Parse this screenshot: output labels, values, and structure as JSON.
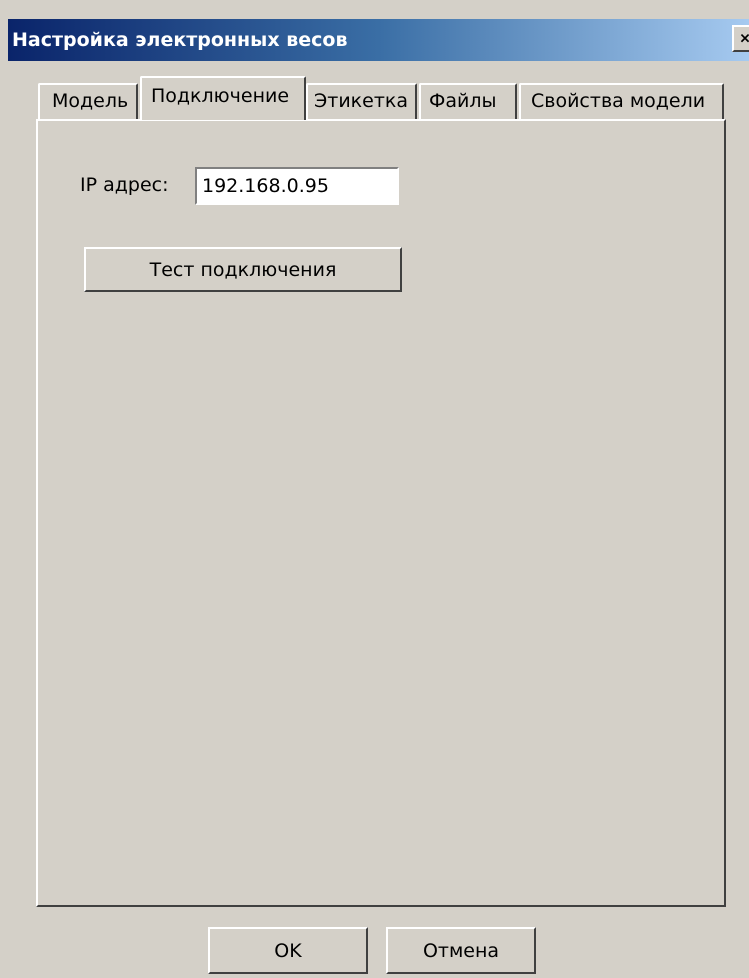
{
  "window": {
    "title": "Настройка электронных весов",
    "close_icon": "close-icon"
  },
  "tabs": [
    {
      "label": "Модель",
      "active": false
    },
    {
      "label": "Подключение",
      "active": true
    },
    {
      "label": "Этикетка",
      "active": false
    },
    {
      "label": "Файлы",
      "active": false
    },
    {
      "label": "Свойства модели",
      "active": false
    }
  ],
  "connection": {
    "ip_label": "IP адрес:",
    "ip_value": "192.168.0.95",
    "test_button_label": "Тест подключения"
  },
  "footer": {
    "ok_label": "OK",
    "cancel_label": "Отмена"
  },
  "colors": {
    "face": "#d4d0c8",
    "title_start": "#0a246a",
    "title_end": "#a6caf0"
  }
}
